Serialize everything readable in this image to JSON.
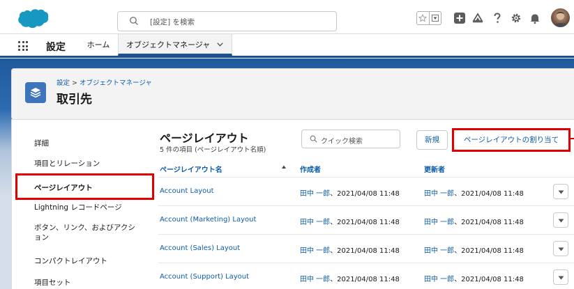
{
  "header": {
    "search_placeholder": "[設定] を検索"
  },
  "nav": {
    "app_name": "設定",
    "home": "ホーム",
    "active_tab": "オブジェクトマネージャ"
  },
  "page_header": {
    "breadcrumb_setup": "設定",
    "breadcrumb_sep": ">",
    "breadcrumb_objmgr": "オブジェクトマネージャ",
    "title": "取引先"
  },
  "sidebar": {
    "items": [
      "詳細",
      "項目とリレーション",
      "ページレイアウト",
      "Lightning レコードページ",
      "ボタン、リンク、およびアクシ",
      "ョン",
      "コンパクトレイアウト",
      "項目セット"
    ]
  },
  "section": {
    "title": "ページレイアウト",
    "subtitle": "5 件の項目 (ページレイアウト名順)",
    "quick_search_placeholder": "クイック検索",
    "new_button": "新規",
    "assign_button": "ページレイアウトの割り当て"
  },
  "table": {
    "columns": [
      "ページレイアウト名",
      "作成者",
      "更新者"
    ],
    "rows": [
      {
        "name": "Account Layout",
        "created_user": "田中 一郎",
        "created_date": "、2021/04/08 11:48",
        "modified_user": "田中 一郎",
        "modified_date": "、2021/04/08 11:48"
      },
      {
        "name": "Account (Marketing) Layout",
        "created_user": "田中 一郎",
        "created_date": "、2021/04/08 11:48",
        "modified_user": "田中 一郎",
        "modified_date": "、2021/04/08 11:48"
      },
      {
        "name": "Account (Sales) Layout",
        "created_user": "田中 一郎",
        "created_date": "、2021/04/08 11:48",
        "modified_user": "田中 一郎",
        "modified_date": "、2021/04/08 11:48"
      },
      {
        "name": "Account (Support) Layout",
        "created_user": "田中 一郎",
        "created_date": "、2021/04/08 11:48",
        "modified_user": "田中 一郎",
        "modified_date": "、2021/04/08 11:48"
      }
    ]
  },
  "colors": {
    "brand_blue": "#1b5297",
    "link": "#0b5cab",
    "highlight_red": "#e00000",
    "cloud": "#1798c1"
  }
}
